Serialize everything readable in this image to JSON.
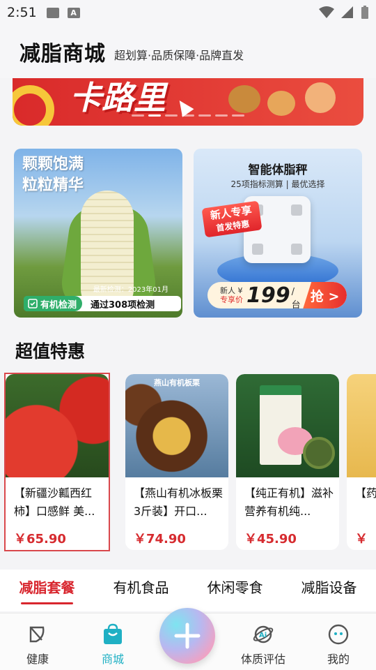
{
  "status_bar": {
    "time": "2:51"
  },
  "header": {
    "title": "减脂商城",
    "subtitle": "超划算·品质保障·品牌直发"
  },
  "banner": {
    "headline": "卡路里"
  },
  "promo_corn": {
    "title_line1": "颗颗饱满",
    "title_line2": "粒粒精华",
    "date": "最新检测：2023年01月",
    "badge_label": "有机检测",
    "badge_text": "通过308项检测"
  },
  "promo_scale": {
    "title": "智能体脂秤",
    "subtitle": "25项指标测算 | 最优选择",
    "new_line1": "新人专享",
    "new_line2": "首发特惠",
    "pill_label1": "新人 ¥",
    "pill_label2": "专享价",
    "price": "199",
    "unit": "/台",
    "button": "抢 >"
  },
  "section": {
    "title": "超值特惠"
  },
  "products": [
    {
      "name": "【新疆沙瓤西红柿】口感鲜 美...",
      "price": "￥65.90"
    },
    {
      "name": "【燕山有机冰板栗3斤装】开口...",
      "price": "￥74.90",
      "tag": "燕山有机板栗"
    },
    {
      "name": "【纯正有机】滋补营养有机纯...",
      "price": "￥45.90"
    },
    {
      "name": "【药",
      "price": "￥"
    }
  ],
  "category_tabs": [
    "减脂套餐",
    "有机食品",
    "休闲零食",
    "减脂设备"
  ],
  "bottom_nav": [
    {
      "label": "健康",
      "icon": "leaf-icon"
    },
    {
      "label": "商城",
      "icon": "shopping-bag-icon"
    },
    {
      "label": "",
      "icon": "plus-icon"
    },
    {
      "label": "体质评估",
      "icon": "ai-planet-icon"
    },
    {
      "label": "我的",
      "icon": "face-icon"
    }
  ],
  "colors": {
    "accent_red": "#d8262e",
    "accent_teal": "#1fb0c4",
    "price_red": "#d62b2f"
  }
}
